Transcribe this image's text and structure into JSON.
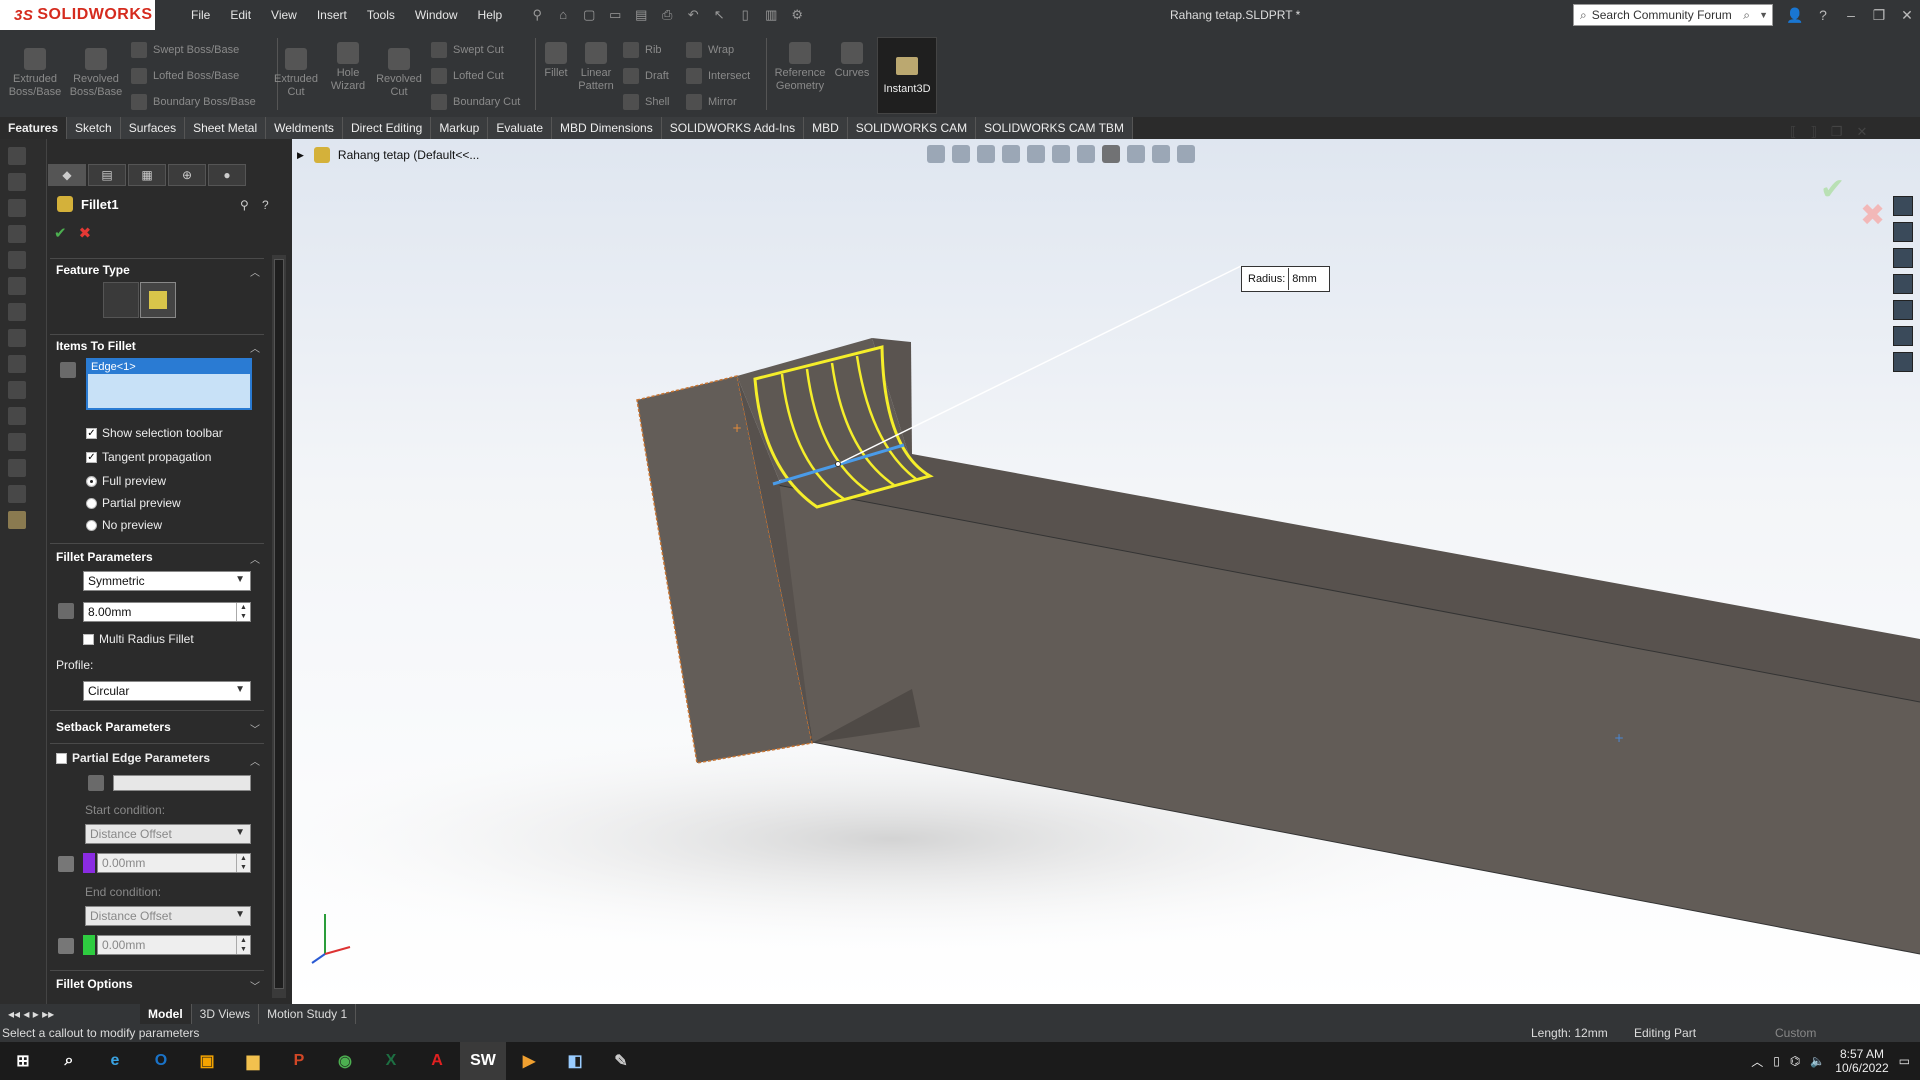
{
  "app": {
    "brand": "SOLIDWORKS",
    "doc_title": "Rahang tetap.SLDPRT *"
  },
  "menu": [
    "File",
    "Edit",
    "View",
    "Insert",
    "Tools",
    "Window",
    "Help"
  ],
  "search": {
    "placeholder": "Search Community Forum"
  },
  "ribbon": {
    "extruded_boss": "Extruded Boss/Base",
    "revolved_boss": "Revolved Boss/Base",
    "swept_boss": "Swept Boss/Base",
    "lofted_boss": "Lofted Boss/Base",
    "boundary_boss": "Boundary Boss/Base",
    "extruded_cut": "Extruded Cut",
    "hole_wizard": "Hole Wizard",
    "revolved_cut": "Revolved Cut",
    "swept_cut": "Swept Cut",
    "lofted_cut": "Lofted Cut",
    "boundary_cut": "Boundary Cut",
    "fillet": "Fillet",
    "linear_pattern": "Linear Pattern",
    "rib": "Rib",
    "draft": "Draft",
    "shell": "Shell",
    "wrap": "Wrap",
    "intersect": "Intersect",
    "mirror": "Mirror",
    "reference_geometry": "Reference Geometry",
    "curves": "Curves",
    "instant3d": "Instant3D"
  },
  "tabs": [
    "Features",
    "Sketch",
    "Surfaces",
    "Sheet Metal",
    "Weldments",
    "Direct Editing",
    "Markup",
    "Evaluate",
    "MBD Dimensions",
    "SOLIDWORKS Add-Ins",
    "MBD",
    "SOLIDWORKS CAM",
    "SOLIDWORKS CAM TBM"
  ],
  "property_manager": {
    "title": "Fillet1",
    "feature_type": "Feature Type",
    "items_to_fillet": "Items To Fillet",
    "edge_item": "Edge<1>",
    "show_selection_toolbar": "Show selection toolbar",
    "tangent_propagation": "Tangent propagation",
    "full_preview": "Full preview",
    "partial_preview": "Partial preview",
    "no_preview": "No preview",
    "fillet_parameters": "Fillet Parameters",
    "fillet_method": "Symmetric",
    "radius_value": "8.00mm",
    "multi_radius": "Multi Radius Fillet",
    "profile_label": "Profile:",
    "profile_value": "Circular",
    "setback_parameters": "Setback Parameters",
    "partial_edge_parameters": "Partial Edge Parameters",
    "start_condition": "Start condition:",
    "start_value": "Distance Offset",
    "start_offset": "0.00mm",
    "end_condition": "End condition:",
    "end_value": "Distance Offset",
    "end_offset": "0.00mm",
    "fillet_options": "Fillet Options"
  },
  "viewport": {
    "tree_label": "Rahang tetap  (Default<<...",
    "radius_label": "Radius:",
    "radius_callout": "8mm"
  },
  "bottom_tabs": [
    "Model",
    "3D Views",
    "Motion Study 1"
  ],
  "status": {
    "message": "Select a callout to modify parameters",
    "length": "Length: 12mm",
    "mode": "Editing Part",
    "units": "Custom"
  },
  "taskbar": {
    "time": "8:57 AM",
    "date": "10/6/2022"
  },
  "colors": {
    "accent": "#2a7bd3",
    "brand": "#d52b1e",
    "model": "#6b6460",
    "preview": "#ffff33"
  }
}
